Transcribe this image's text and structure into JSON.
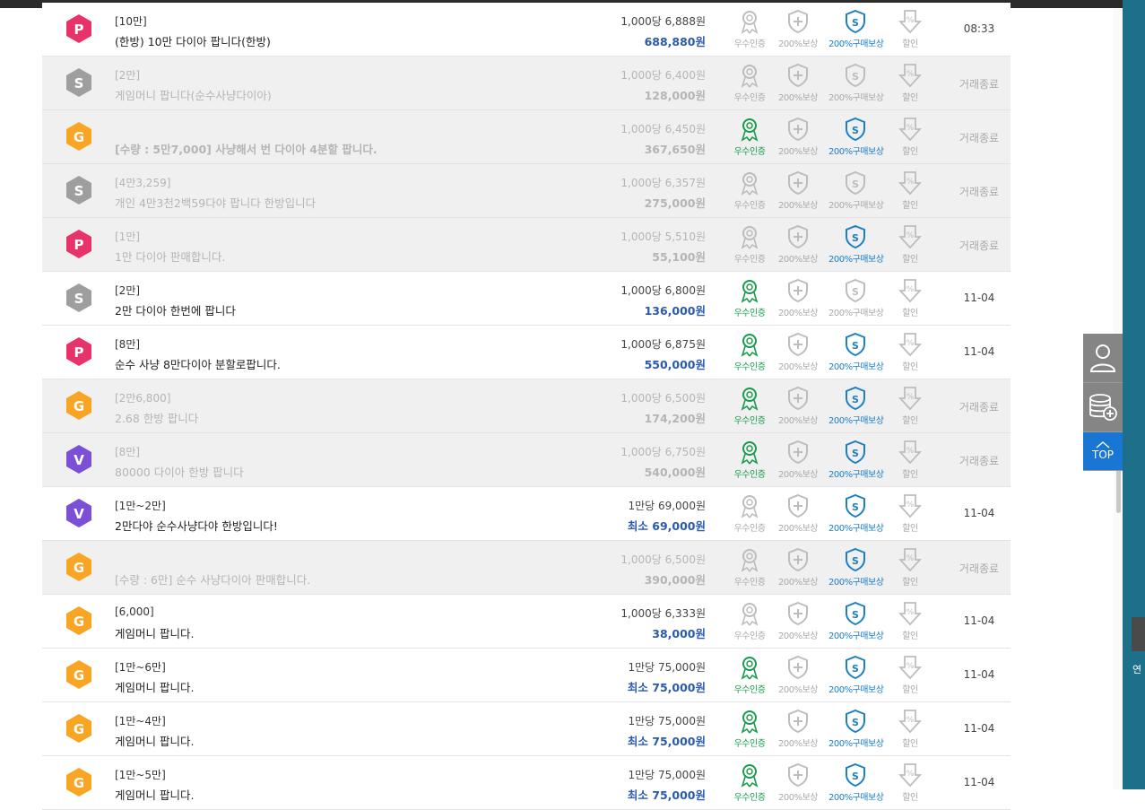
{
  "side": {
    "top_label": "TOP"
  },
  "rows": [
    {
      "badge": "P",
      "color": "#e8336a",
      "cat": "[10만]",
      "title": "(한방) 10만 다이아 팝니다(한방)",
      "unit": "1,000당 6,888원",
      "total": "688,880원",
      "f1": false,
      "f3": true,
      "date": "08:33",
      "ended": false,
      "bold": false
    },
    {
      "badge": "S",
      "color": "#9e9e9e",
      "cat": "[2만]",
      "title": "게임머니 팝니다(순수사냥다이아)",
      "unit": "1,000당 6,400원",
      "total": "128,000원",
      "f1": false,
      "f3": false,
      "date": "거래종료",
      "ended": true,
      "bold": false
    },
    {
      "badge": "G",
      "color": "#f7a523",
      "cat": "",
      "title": "[수량 : 5만7,000] 사냥해서 번 다이아 4분할 팝니다.",
      "unit": "1,000당 6,450원",
      "total": "367,650원",
      "f1": true,
      "f3": true,
      "date": "거래종료",
      "ended": true,
      "bold": true
    },
    {
      "badge": "S",
      "color": "#9e9e9e",
      "cat": "[4만3,259]",
      "title": "개인 4만3천2백59다야 팝니다 한방입니다",
      "unit": "1,000당 6,357원",
      "total": "275,000원",
      "f1": false,
      "f3": false,
      "date": "거래종료",
      "ended": true,
      "bold": false
    },
    {
      "badge": "P",
      "color": "#e8336a",
      "cat": "[1만]",
      "title": "1만 다이아 판매합니다.",
      "unit": "1,000당 5,510원",
      "total": "55,100원",
      "f1": false,
      "f3": true,
      "date": "거래종료",
      "ended": true,
      "bold": false
    },
    {
      "badge": "S",
      "color": "#9e9e9e",
      "cat": "[2만]",
      "title": "2만 다이아 한번에 팝니다",
      "unit": "1,000당 6,800원",
      "total": "136,000원",
      "f1": true,
      "f3": false,
      "date": "11-04",
      "ended": false,
      "bold": false
    },
    {
      "badge": "P",
      "color": "#e8336a",
      "cat": "[8만]",
      "title": "순수 사냥 8만다이아 분할로팝니다.",
      "unit": "1,000당 6,875원",
      "total": "550,000원",
      "f1": true,
      "f3": true,
      "date": "11-04",
      "ended": false,
      "bold": false
    },
    {
      "badge": "G",
      "color": "#f7a523",
      "cat": "[2만6,800]",
      "title": "2.68 한방 팝니다",
      "unit": "1,000당 6,500원",
      "total": "174,200원",
      "f1": true,
      "f3": true,
      "date": "거래종료",
      "ended": true,
      "bold": false
    },
    {
      "badge": "V",
      "color": "#7b4fd6",
      "cat": "[8만]",
      "title": "80000 다이아 한방 팝니다",
      "unit": "1,000당 6,750원",
      "total": "540,000원",
      "f1": true,
      "f3": true,
      "date": "거래종료",
      "ended": true,
      "bold": false
    },
    {
      "badge": "V",
      "color": "#7b4fd6",
      "cat": "[1만~2만]",
      "title": "2만다야 순수사냥다야 한방입니다!",
      "unit": "1만당 69,000원",
      "total": "최소 69,000원",
      "f1": false,
      "f3": true,
      "date": "11-04",
      "ended": false,
      "bold": false
    },
    {
      "badge": "G",
      "color": "#f7a523",
      "cat": "",
      "title": "[수량 : 6만] 순수 사냥다이아 판매합니다.",
      "unit": "1,000당 6,500원",
      "total": "390,000원",
      "f1": false,
      "f3": true,
      "date": "거래종료",
      "ended": true,
      "bold": false
    },
    {
      "badge": "G",
      "color": "#f7a523",
      "cat": "[6,000]",
      "title": "게임머니 팝니다.",
      "unit": "1,000당 6,333원",
      "total": "38,000원",
      "f1": false,
      "f3": true,
      "date": "11-04",
      "ended": false,
      "bold": false
    },
    {
      "badge": "G",
      "color": "#f7a523",
      "cat": "[1만~6만]",
      "title": "게임머니 팝니다.",
      "unit": "1만당 75,000원",
      "total": "최소 75,000원",
      "f1": true,
      "f3": true,
      "date": "11-04",
      "ended": false,
      "bold": false
    },
    {
      "badge": "G",
      "color": "#f7a523",
      "cat": "[1만~4만]",
      "title": "게임머니 팝니다.",
      "unit": "1만당 75,000원",
      "total": "최소 75,000원",
      "f1": true,
      "f3": true,
      "date": "11-04",
      "ended": false,
      "bold": false
    },
    {
      "badge": "G",
      "color": "#f7a523",
      "cat": "[1만~5만]",
      "title": "게임머니 팝니다.",
      "unit": "1만당 75,000원",
      "total": "최소 75,000원",
      "f1": true,
      "f3": true,
      "date": "11-04",
      "ended": false,
      "bold": false
    }
  ],
  "feature_labels": {
    "f1": "우수인증",
    "f2": "200%보상",
    "f3": "200%구매보상",
    "f4": "할인"
  },
  "colors": {
    "green": "#1a9b4e",
    "blue": "#1d7fc4",
    "gray": "#bdbdbd"
  },
  "thumb_text": "연"
}
